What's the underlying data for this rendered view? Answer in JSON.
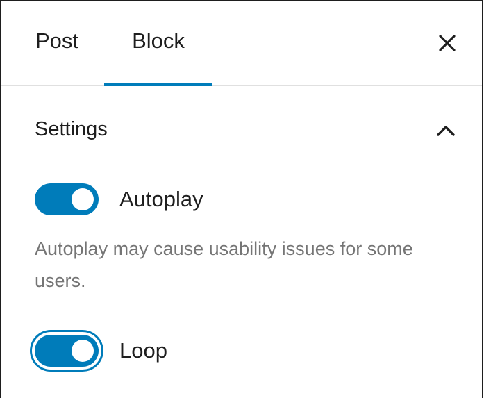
{
  "tabs": [
    {
      "label": "Post",
      "active": false
    },
    {
      "label": "Block",
      "active": true
    }
  ],
  "header": {
    "close_icon": "close-icon"
  },
  "settings": {
    "title": "Settings",
    "collapse_icon": "chevron-up-icon",
    "autoplay": {
      "label": "Autoplay",
      "checked": true,
      "help": "Autoplay may cause usability issues for some users."
    },
    "loop": {
      "label": "Loop",
      "checked": true,
      "focused": true
    }
  },
  "colors": {
    "accent": "#007cba",
    "text": "#1e1e1e",
    "help_text": "#757575",
    "divider": "#e0e0e0"
  }
}
